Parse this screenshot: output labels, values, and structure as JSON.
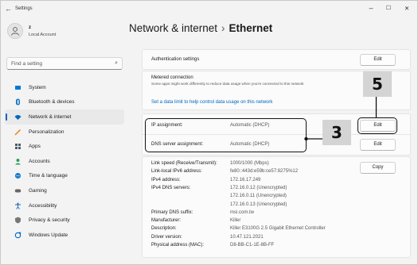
{
  "window": {
    "title": "Settings",
    "back": "←",
    "minimize": "–",
    "maximize": "☐",
    "close": "✕"
  },
  "user": {
    "name": "z",
    "account": "Local Account"
  },
  "search": {
    "placeholder": "Find a setting"
  },
  "nav": [
    {
      "label": "System",
      "icon": "system-icon",
      "color": "#0078d4"
    },
    {
      "label": "Bluetooth & devices",
      "icon": "bluetooth-icon",
      "color": "#0067c0"
    },
    {
      "label": "Network & internet",
      "icon": "wifi-icon",
      "color": "#0067c0",
      "active": true
    },
    {
      "label": "Personalization",
      "icon": "brush-icon",
      "color": "#e8912d"
    },
    {
      "label": "Apps",
      "icon": "apps-icon",
      "color": "#4a5a70"
    },
    {
      "label": "Accounts",
      "icon": "person-icon",
      "color": "#2e9e5b"
    },
    {
      "label": "Time & language",
      "icon": "globe-clock-icon",
      "color": "#1a7fcf"
    },
    {
      "label": "Gaming",
      "icon": "gamepad-icon",
      "color": "#666666"
    },
    {
      "label": "Accessibility",
      "icon": "accessibility-icon",
      "color": "#1a5fb4"
    },
    {
      "label": "Privacy & security",
      "icon": "shield-icon",
      "color": "#777777"
    },
    {
      "label": "Windows Update",
      "icon": "update-icon",
      "color": "#0067c0"
    }
  ],
  "breadcrumb": {
    "parent": "Network & internet",
    "separator": "›",
    "current": "Ethernet"
  },
  "auth": {
    "label": "Authentication settings",
    "button": "Edit"
  },
  "metered": {
    "label": "Metered connection",
    "desc": "Some apps might work differently to reduce data usage when you're connected to this network",
    "link": "Set a data limit to help control data usage on this network"
  },
  "ip": {
    "assignment_label": "IP assignment:",
    "assignment_value": "Automatic (DHCP)",
    "dns_label": "DNS server assignment:",
    "dns_value": "Automatic (DHCP)",
    "edit": "Edit"
  },
  "properties": {
    "copy": "Copy",
    "rows": [
      {
        "label": "Link speed (Receive/Transmit):",
        "value": "1000/1000 (Mbps)"
      },
      {
        "label": "Link-local IPv6 address:",
        "value": "fe80::443d:e59b:ce57:8275%12"
      },
      {
        "label": "IPv4 address:",
        "value": "172.16.17.249"
      },
      {
        "label": "IPv4 DNS servers:",
        "value": "172.16.0.12 (Unencrypted)"
      },
      {
        "label": "",
        "value": "172.16.0.11 (Unencrypted)"
      },
      {
        "label": "",
        "value": "172.16.0.13 (Unencrypted)"
      },
      {
        "label": "Primary DNS suffix:",
        "value": "msi.com.tw"
      },
      {
        "label": "Manufacturer:",
        "value": "Killer"
      },
      {
        "label": "Description:",
        "value": "Killer E3100G 2.5 Gigabit Ethernet Controller"
      },
      {
        "label": "Driver version:",
        "value": "10.47.121.2021"
      },
      {
        "label": "Physical address (MAC):",
        "value": "D8-BB-C1-1E-8B-FF"
      }
    ]
  },
  "callouts": {
    "three": "3",
    "five": "5"
  }
}
